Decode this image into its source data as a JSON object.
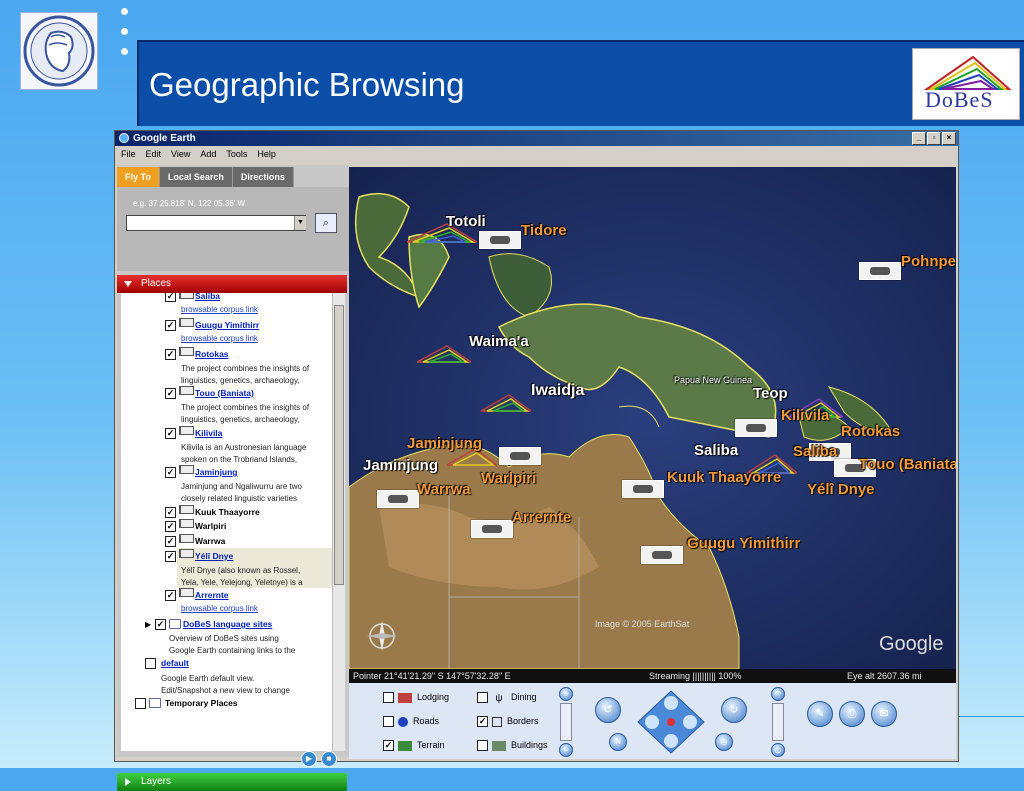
{
  "slide": {
    "title": "Geographic Browsing",
    "logo_right_text": "DoBeS"
  },
  "window": {
    "title": "Google Earth",
    "menu": [
      "File",
      "Edit",
      "View",
      "Add",
      "Tools",
      "Help"
    ]
  },
  "search": {
    "tabs": [
      "Fly To",
      "Local Search",
      "Directions"
    ],
    "active_tab": "Fly To",
    "example": "e.g. 37 25.818' N, 122 05.36' W",
    "input_value": ""
  },
  "places": {
    "header": "Places",
    "items": [
      {
        "name": "Saliba",
        "link": true,
        "checked": true,
        "sub": "browsable corpus link"
      },
      {
        "name": "Guugu Yimithirr",
        "link": true,
        "checked": true,
        "sub": "browsable corpus link"
      },
      {
        "name": "Rotokas",
        "link": true,
        "checked": true,
        "desc1": "The project combines the insights of",
        "desc2": "linguistics, genetics, archaeology,"
      },
      {
        "name": "Touo (Baniata)",
        "link": true,
        "checked": true,
        "desc1": "The project combines the insights of",
        "desc2": "linguistics, genetics, archaeology,"
      },
      {
        "name": "Kilivila",
        "link": true,
        "checked": true,
        "desc1": "Kilivila is an Austronesian language",
        "desc2": "spoken on the Trobriand Islands,"
      },
      {
        "name": "Jaminjung",
        "link": true,
        "checked": true,
        "desc1": "Jaminjung and Ngaliwurru are two",
        "desc2": "closely related linguistic varieties"
      },
      {
        "name": "Kuuk Thaayorre",
        "link": false,
        "checked": true
      },
      {
        "name": "Warlpiri",
        "link": false,
        "checked": true
      },
      {
        "name": "Warrwa",
        "link": false,
        "checked": true
      },
      {
        "name": "Yélî Dnye",
        "link": true,
        "checked": true,
        "desc1": "Yélî Dnye (also known as Rossel,",
        "desc2": "Yela, Yele, Yelejong, Yeletnye) is a"
      },
      {
        "name": "Arrernte",
        "link": true,
        "checked": true,
        "sub": "browsable corpus link"
      }
    ],
    "folder_dobes": {
      "name": "DoBeS language sites",
      "desc1": "Overview of DoBeS sites using",
      "desc2": "Google Earth containing links to the"
    },
    "folder_default": {
      "name": "default",
      "desc1": "Google Earth default view.",
      "desc2": "Edit/Snapshot a new view to change"
    },
    "folder_temp": {
      "name": "Temporary Places"
    }
  },
  "layers": {
    "header": "Layers",
    "options": [
      {
        "label": "Lodging",
        "checked": false
      },
      {
        "label": "Dining",
        "checked": false
      },
      {
        "label": "Roads",
        "checked": false
      },
      {
        "label": "Borders",
        "checked": true
      },
      {
        "label": "Terrain",
        "checked": true
      },
      {
        "label": "Buildings",
        "checked": false
      }
    ]
  },
  "map": {
    "labels": [
      {
        "text": "Totoli",
        "color": "white"
      },
      {
        "text": "Tidore",
        "color": "orange"
      },
      {
        "text": "Pohnpei",
        "color": "orange"
      },
      {
        "text": "Waima'a",
        "color": "white"
      },
      {
        "text": "Papua New Guinea",
        "color": "white"
      },
      {
        "text": "Iwaidja",
        "color": "white"
      },
      {
        "text": "Teop",
        "color": "white"
      },
      {
        "text": "Kilivila",
        "color": "orange"
      },
      {
        "text": "Rotokas",
        "color": "orange"
      },
      {
        "text": "Jaminjung",
        "color": "orange"
      },
      {
        "text": "Saliba",
        "color": "white"
      },
      {
        "text": "Saliba",
        "color": "orange"
      },
      {
        "text": "Jaminjung",
        "color": "white"
      },
      {
        "text": "Touo (Baniata)",
        "color": "orange"
      },
      {
        "text": "Warlpiri",
        "color": "orange"
      },
      {
        "text": "Kuuk Thaayorre",
        "color": "orange"
      },
      {
        "text": "Yélî Dnye",
        "color": "orange"
      },
      {
        "text": "Warrwa",
        "color": "orange"
      },
      {
        "text": "Arrernte",
        "color": "orange"
      },
      {
        "text": "Guugu Yimithirr",
        "color": "orange"
      }
    ],
    "copyright": "Image © 2005 EarthSat",
    "google": "Google"
  },
  "status": {
    "pointer": "Pointer  21°41'21.29\"  S   147°57'32.28\"  E",
    "streaming": "Streaming |||||||||| 100%",
    "eye_alt": "Eye  alt  2607.36 mi"
  }
}
